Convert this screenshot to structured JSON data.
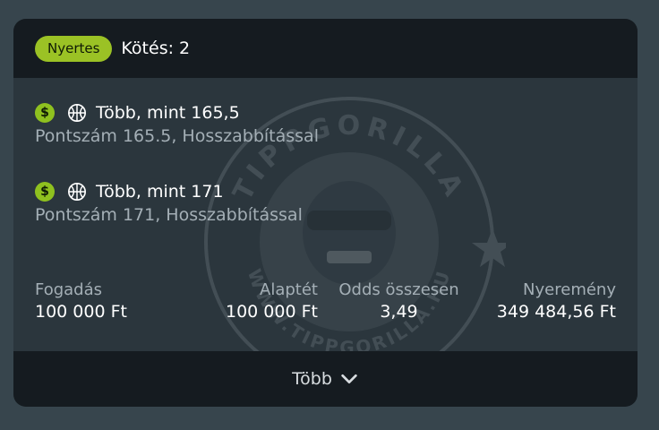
{
  "header": {
    "badge": "Nyertes",
    "title": "Kötés: 2"
  },
  "bets": [
    {
      "title": "Több, mint 165,5",
      "subtitle": "Pontszám 165.5, Hosszabbítással",
      "status_icon": "dollar-icon",
      "sport_icon": "basketball-icon"
    },
    {
      "title": "Több, mint 171",
      "subtitle": "Pontszám 171, Hosszabbítással",
      "status_icon": "dollar-icon",
      "sport_icon": "basketball-icon"
    }
  ],
  "stats": {
    "stake": {
      "label": "Fogadás",
      "value": "100 000 Ft"
    },
    "base": {
      "label": "Alaptét",
      "value": "100 000 Ft"
    },
    "odds": {
      "label": "Odds összesen",
      "value": "3,49"
    },
    "payout": {
      "label": "Nyeremény",
      "value": "349 484,56 Ft"
    }
  },
  "footer": {
    "more_label": "Több",
    "icon": "chevron-down-icon"
  },
  "watermark": {
    "text_top": "TIPPGORILLA",
    "text_bottom": "WWW.TIPPGORILLA.HU"
  },
  "colors": {
    "background": "#37454d",
    "card_header": "#151b20",
    "card_body": "#2b363d",
    "accent_green": "#9bc225",
    "text_primary": "#ffffff",
    "text_secondary": "#a4afb6"
  }
}
